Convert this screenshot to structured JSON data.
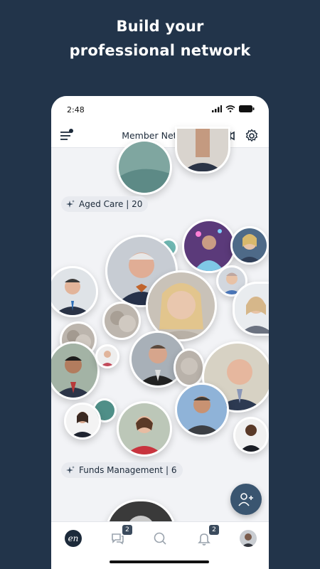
{
  "promo": {
    "line1": "Build your",
    "line2": "professional network"
  },
  "status": {
    "time": "2:48"
  },
  "header": {
    "title": "Member Network"
  },
  "groups": [
    {
      "name": "Aged Care",
      "count": "| 20"
    },
    {
      "name": "Funds Management",
      "count": "| 6"
    }
  ],
  "nav": {
    "messages_badge": "2",
    "notifications_badge": "2",
    "logo_text": "en"
  },
  "colors": {
    "background": "#22344a",
    "accent": "#3a5570"
  }
}
